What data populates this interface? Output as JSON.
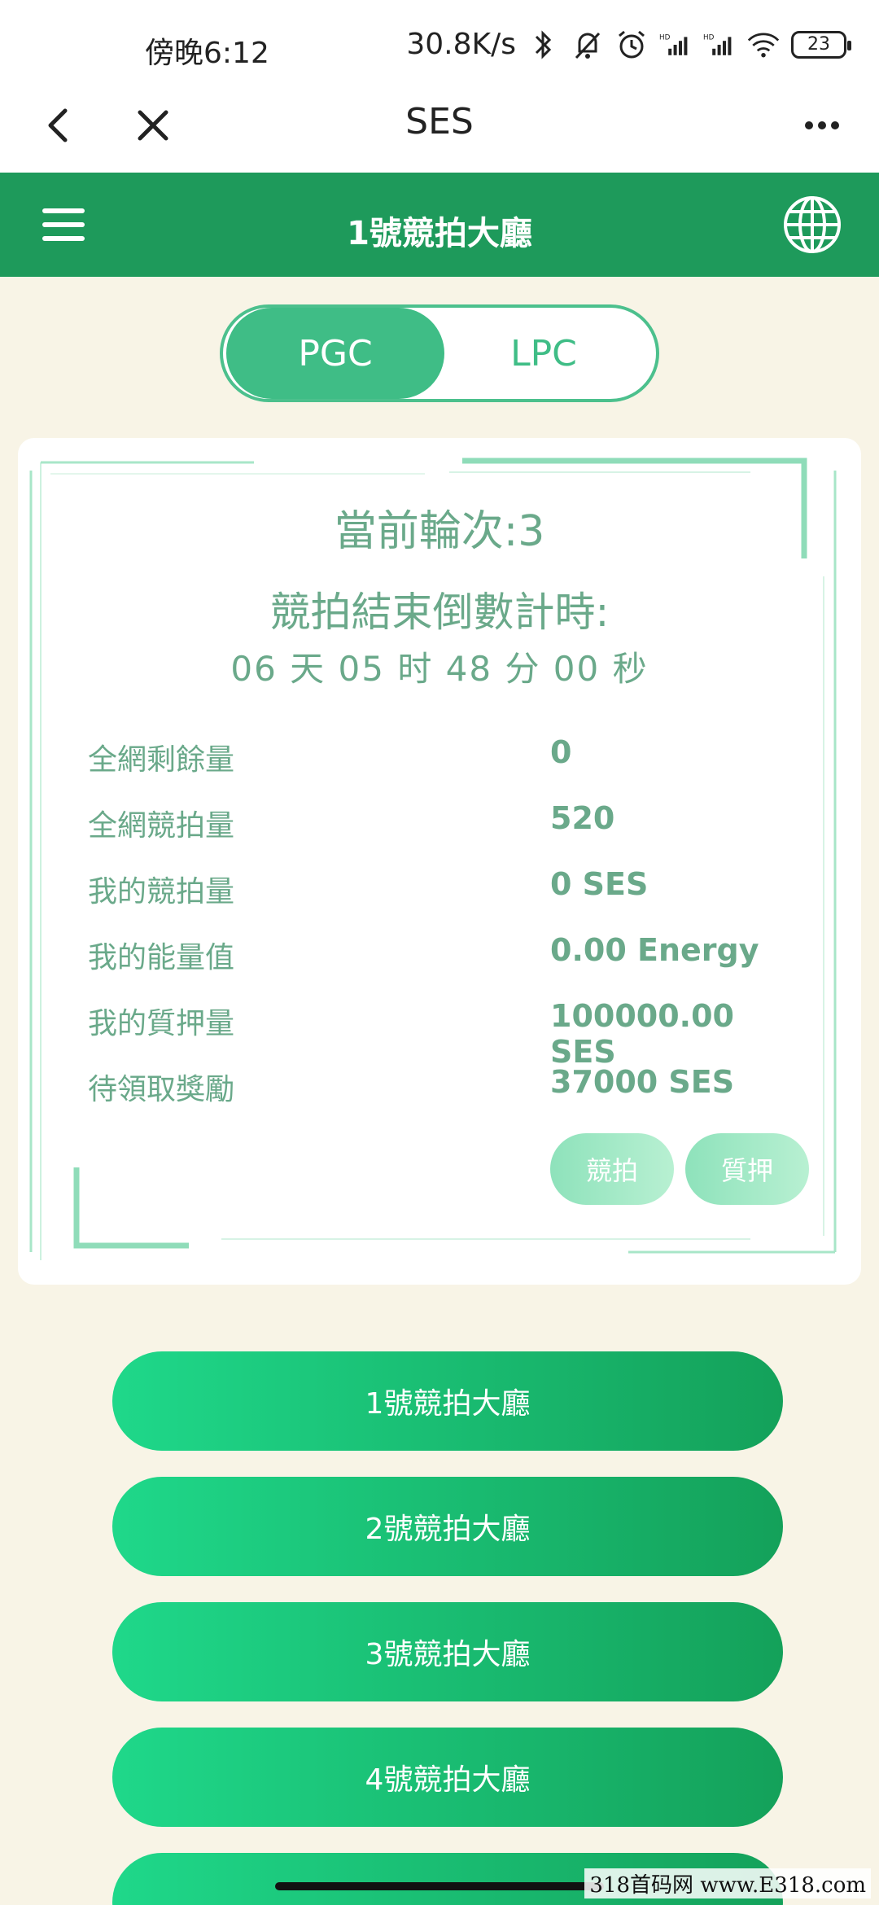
{
  "status_bar": {
    "time": "傍晚6:12",
    "network_speed": "30.8K/s",
    "battery": "23",
    "icons": [
      "bluetooth-icon",
      "mute-bell-icon",
      "alarm-icon",
      "signal-hd-icon",
      "signal-hd-icon",
      "wifi-icon"
    ]
  },
  "browser": {
    "title": "SES",
    "back_icon": "chevron-left-icon",
    "close_icon": "close-icon",
    "more_icon": "more-dots-icon"
  },
  "header": {
    "title": "1號競拍大廳",
    "menu_icon": "hamburger-icon",
    "lang_icon": "globe-icon"
  },
  "toggle": {
    "options": [
      "PGC",
      "LPC"
    ],
    "selected": "PGC"
  },
  "card": {
    "round_label": "當前輪次:3",
    "countdown_label": "競拍結束倒數計時:",
    "countdown_value": "06 天 05 时 48 分 00 秒",
    "stats": [
      {
        "label": "全網剩餘量",
        "value": "0"
      },
      {
        "label": "全網競拍量",
        "value": "520"
      },
      {
        "label": "我的競拍量",
        "value": "0 SES"
      },
      {
        "label": "我的能量值",
        "value": "0.00 Energy"
      },
      {
        "label": "我的質押量",
        "value": "100000.00 SES"
      },
      {
        "label": "待領取獎勵",
        "value": "37000 SES"
      }
    ],
    "bid_button": "競拍",
    "pledge_button": "質押"
  },
  "halls": [
    {
      "label": "1號競拍大廳"
    },
    {
      "label": "2號競拍大廳"
    },
    {
      "label": "3號競拍大廳"
    },
    {
      "label": "4號競拍大廳"
    }
  ],
  "watermark": "318首码网 www.E318.com",
  "colors": {
    "header_green": "#1e9a5b",
    "accent_green": "#3fbd86",
    "text_green": "#6aa98a",
    "background": "#f8f4e6"
  }
}
